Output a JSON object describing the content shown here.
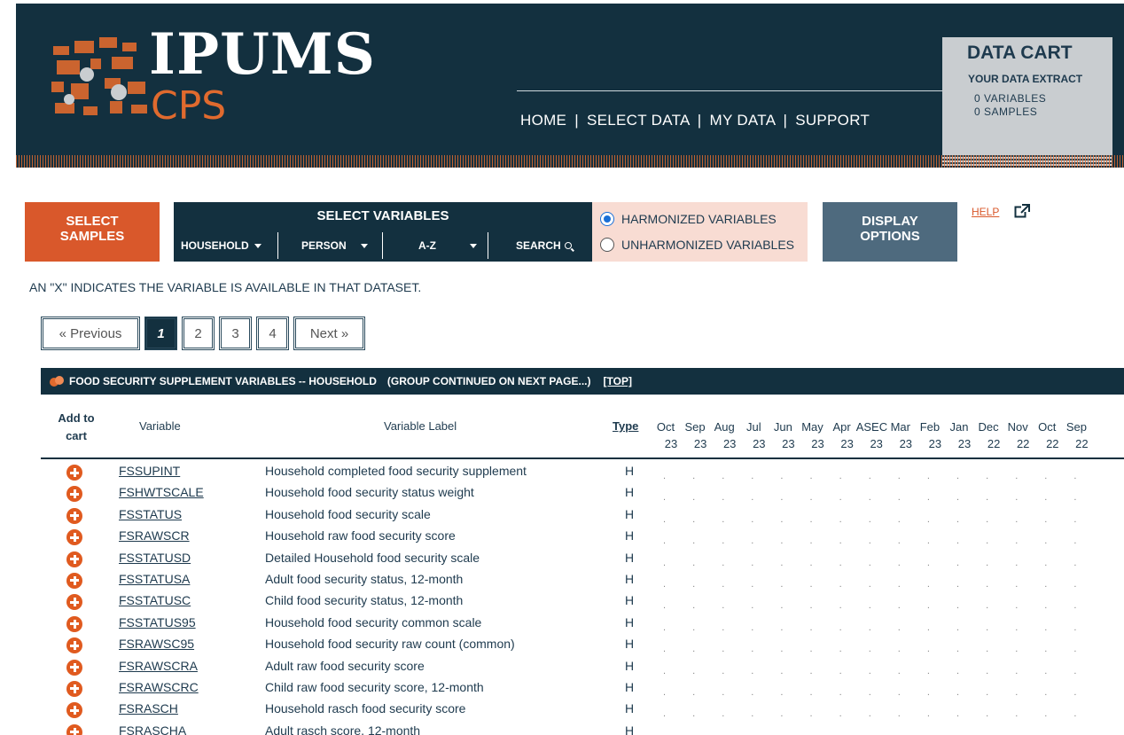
{
  "brand": {
    "name": "IPUMS",
    "product": "CPS"
  },
  "nav": {
    "items": [
      "HOME",
      "SELECT DATA",
      "MY DATA",
      "SUPPORT"
    ],
    "separator": "|"
  },
  "cart": {
    "title": "DATA CART",
    "subtitle": "YOUR DATA EXTRACT",
    "variables": "0 VARIABLES",
    "samples": "0 SAMPLES"
  },
  "toolbar": {
    "select_samples": "SELECT SAMPLES",
    "select_variables": "SELECT VARIABLES",
    "var_menus": [
      "HOUSEHOLD",
      "PERSON",
      "A-Z",
      "SEARCH"
    ],
    "harmonized": "HARMONIZED VARIABLES",
    "unharmonized": "UNHARMONIZED VARIABLES",
    "harmonized_selected": true,
    "display_options": "DISPLAY OPTIONS",
    "help": "HELP"
  },
  "availability_note": "AN \"X\" INDICATES THE VARIABLE IS AVAILABLE IN THAT DATASET.",
  "pagination": {
    "previous": "« Previous",
    "pages": [
      "1",
      "2",
      "3",
      "4"
    ],
    "current": "1",
    "next": "Next »"
  },
  "group": {
    "title": "FOOD SECURITY SUPPLEMENT VARIABLES -- HOUSEHOLD",
    "continued": "(GROUP CONTINUED ON NEXT PAGE...)",
    "top_link": "[TOP]"
  },
  "table": {
    "headers": {
      "add_to_cart": "Add to cart",
      "variable": "Variable",
      "label": "Variable Label",
      "type": "Type"
    },
    "date_columns": [
      [
        "Oct",
        "23"
      ],
      [
        "Sep",
        "23"
      ],
      [
        "Aug",
        "23"
      ],
      [
        "Jul",
        "23"
      ],
      [
        "Jun",
        "23"
      ],
      [
        "May",
        "23"
      ],
      [
        "Apr",
        "23"
      ],
      [
        "ASEC",
        "23"
      ],
      [
        "Mar",
        "23"
      ],
      [
        "Feb",
        "23"
      ],
      [
        "Jan",
        "23"
      ],
      [
        "Dec",
        "22"
      ],
      [
        "Nov",
        "22"
      ],
      [
        "Oct",
        "22"
      ],
      [
        "Sep",
        "22"
      ]
    ],
    "availability_mark": ".",
    "rows": [
      {
        "variable": "FSSUPINT",
        "label": "Household completed food security supplement",
        "type": "H"
      },
      {
        "variable": "FSHWTSCALE",
        "label": "Household food security status weight",
        "type": "H"
      },
      {
        "variable": "FSSTATUS",
        "label": "Household food security scale",
        "type": "H"
      },
      {
        "variable": "FSRAWSCR",
        "label": "Household raw food security score",
        "type": "H"
      },
      {
        "variable": "FSSTATUSD",
        "label": "Detailed Household food security scale",
        "type": "H"
      },
      {
        "variable": "FSSTATUSA",
        "label": "Adult food security status, 12-month",
        "type": "H"
      },
      {
        "variable": "FSSTATUSC",
        "label": "Child food security status, 12-month",
        "type": "H"
      },
      {
        "variable": "FSSTATUS95",
        "label": "Household food security common scale",
        "type": "H"
      },
      {
        "variable": "FSRAWSC95",
        "label": "Household food security raw count (common)",
        "type": "H"
      },
      {
        "variable": "FSRAWSCRA",
        "label": "Adult raw food security score",
        "type": "H"
      },
      {
        "variable": "FSRAWSCRC",
        "label": "Child raw food security score, 12-month",
        "type": "H"
      },
      {
        "variable": "FSRASCH",
        "label": "Household rasch food security score",
        "type": "H"
      },
      {
        "variable": "FSRASCHA",
        "label": "Adult rasch score, 12-month",
        "type": "H"
      }
    ]
  },
  "colors": {
    "navy": "#13303f",
    "orange": "#d9582b",
    "slate": "#4e6a7e",
    "pink": "#f8dcd3"
  }
}
